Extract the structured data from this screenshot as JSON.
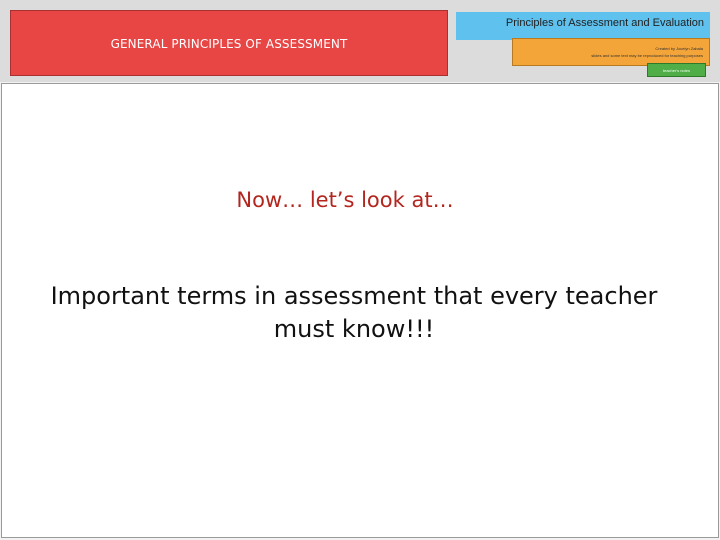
{
  "header": {
    "red_title": "GENERAL PRINCIPLES OF ASSESSMENT",
    "blue_title": "Principles of Assessment and Evaluation",
    "orange_line1": "Created by Jocelyn Zabala",
    "orange_line2": "slides and some text may be reproduced for teaching purposes",
    "badge_text": "teacher's notes",
    "colors": {
      "red": "#e84545",
      "blue": "#5fc1ee",
      "orange": "#f4a53a",
      "green": "#4fae48"
    }
  },
  "slide": {
    "subheading": "Now… let’s look at…",
    "main_text": "Important terms in assessment that every teacher must know!!!",
    "subheading_color": "#b3261e"
  }
}
